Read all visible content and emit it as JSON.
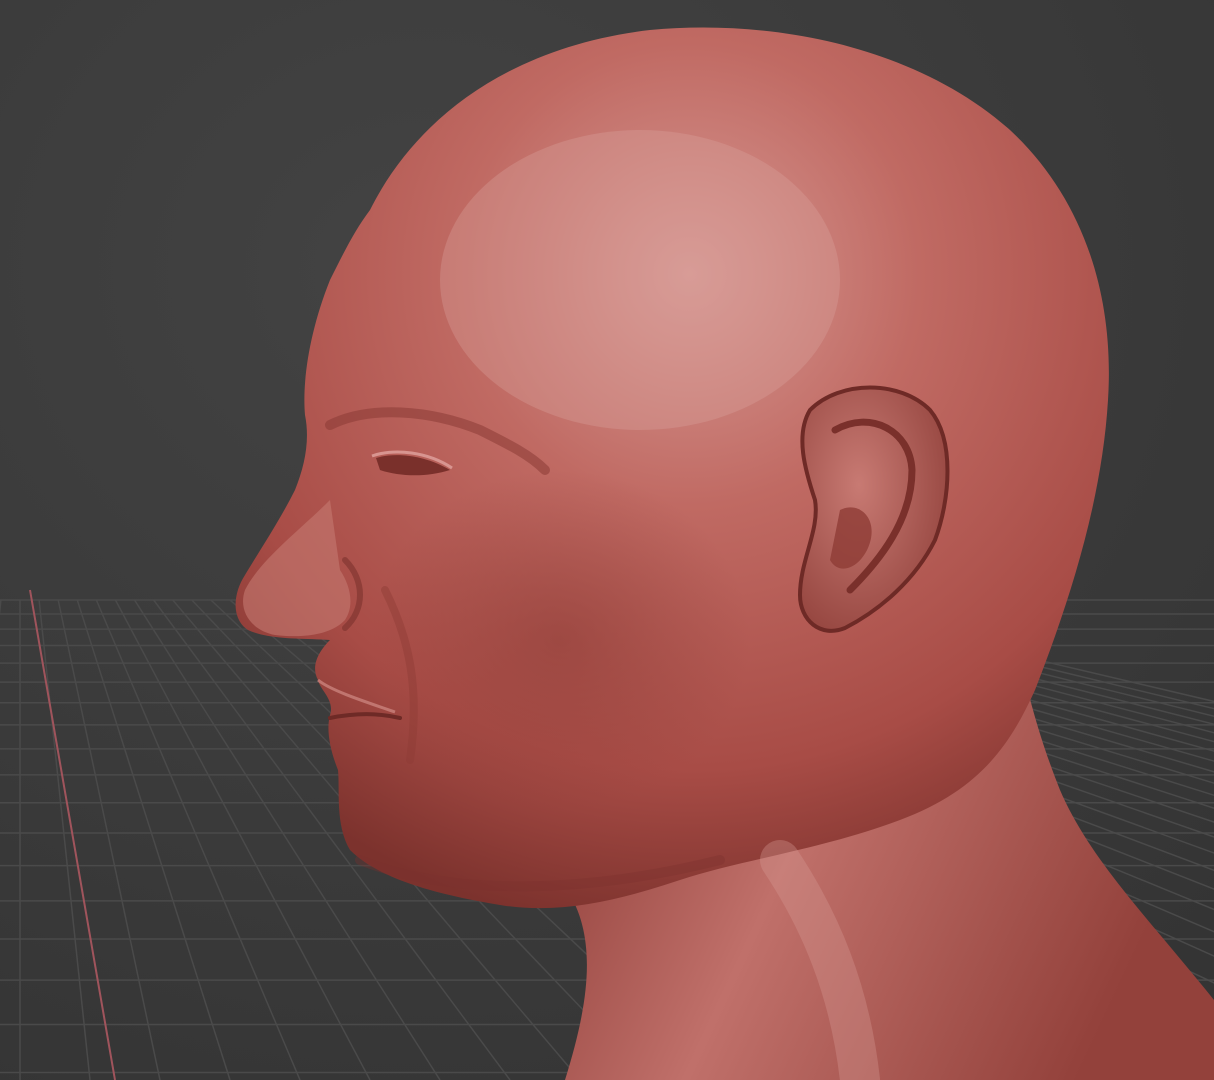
{
  "viewport": {
    "mode": "3d-sculpt-viewport",
    "background_color": "#3c3c3c",
    "grid_line_color": "#4a4a4a",
    "axis_line_color": "#a0545c",
    "model": {
      "subject": "bust-head-profile",
      "material_color": "#b5554f",
      "highlight_color": "#d08a84",
      "shadow_color": "#6e2a26"
    }
  }
}
